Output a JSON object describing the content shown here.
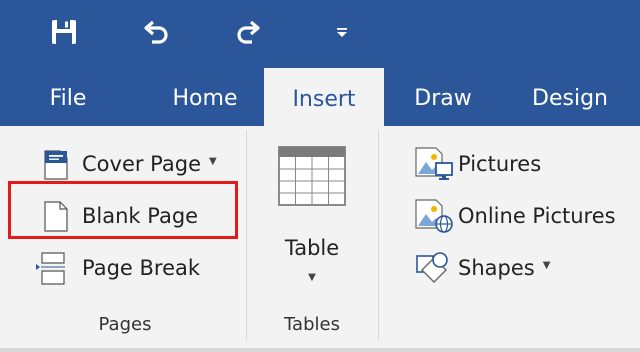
{
  "qat": {
    "save_icon": "save-icon",
    "undo_icon": "undo-icon",
    "redo_icon": "redo-icon",
    "customize_icon": "customize-qat-icon"
  },
  "tabs": [
    {
      "label": "File",
      "active": false
    },
    {
      "label": "Home",
      "active": false
    },
    {
      "label": "Insert",
      "active": true
    },
    {
      "label": "Draw",
      "active": false
    },
    {
      "label": "Design",
      "active": false
    }
  ],
  "pages_group": {
    "label": "Pages",
    "items": [
      {
        "label": "Cover Page",
        "icon": "cover-page-icon",
        "has_dropdown": true
      },
      {
        "label": "Blank Page",
        "icon": "blank-page-icon",
        "has_dropdown": false,
        "highlighted": true
      },
      {
        "label": "Page Break",
        "icon": "page-break-icon",
        "has_dropdown": false
      }
    ]
  },
  "tables_group": {
    "label": "Tables",
    "button_label": "Table",
    "icon": "table-grid-icon",
    "has_dropdown": true
  },
  "illustrations_group": {
    "items": [
      {
        "label": "Pictures",
        "icon": "pictures-icon",
        "has_dropdown": false
      },
      {
        "label": "Online Pictures",
        "icon": "online-pictures-icon",
        "has_dropdown": false
      },
      {
        "label": "Shapes",
        "icon": "shapes-icon",
        "has_dropdown": true
      }
    ]
  },
  "colors": {
    "accent": "#2b579a",
    "ribbon_bg": "#f3f3f3",
    "highlight_border": "#e21a1a"
  }
}
